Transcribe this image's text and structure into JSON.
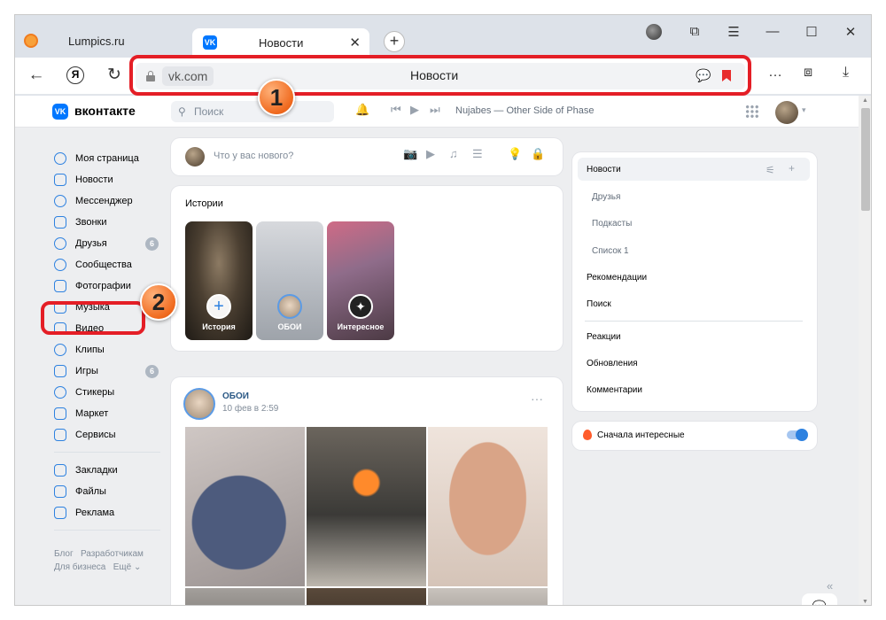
{
  "browser": {
    "inactive_tab": "Lumpics.ru",
    "active_tab": {
      "title": "Новости",
      "favicon": "VK",
      "close": "✕"
    },
    "new_tab": "+",
    "window_controls": {
      "extensions": "⧉",
      "menu": "☰",
      "minimize": "—",
      "maximize": "☐",
      "close": "✕"
    },
    "nav": {
      "back": "←",
      "yandex": "Я",
      "reload": "↻"
    },
    "address": {
      "domain": "vk.com",
      "title": "Новости"
    },
    "right_controls": {
      "more": "…",
      "downloads": "⤓",
      "bookmarks": "⧈"
    }
  },
  "annotations": {
    "badge_1": "1",
    "badge_2": "2",
    "color": "#e41e26"
  },
  "vk": {
    "logo_text": "вконтакте",
    "search_placeholder": "Поиск",
    "player": {
      "track": "Nujabes — Other Side of Phase"
    },
    "menu": [
      {
        "label": "Моя страница"
      },
      {
        "label": "Новости"
      },
      {
        "label": "Мессенджер"
      },
      {
        "label": "Звонки"
      },
      {
        "label": "Друзья",
        "count": "6"
      },
      {
        "label": "Сообщества"
      },
      {
        "label": "Фотографии"
      },
      {
        "label": "Музыка"
      },
      {
        "label": "Видео"
      },
      {
        "label": "Клипы"
      },
      {
        "label": "Игры",
        "count": "6"
      },
      {
        "label": "Стикеры"
      },
      {
        "label": "Маркет"
      },
      {
        "label": "Сервисы"
      },
      {
        "label": "Закладки"
      },
      {
        "label": "Файлы"
      },
      {
        "label": "Реклама"
      }
    ],
    "footer": {
      "blog": "Блог",
      "developers": "Разработчикам",
      "business": "Для бизнеса",
      "more": "Ещё"
    },
    "composer_placeholder": "Что у вас нового?",
    "stories": {
      "title": "Истории",
      "items": [
        {
          "label": "История",
          "icon": "+"
        },
        {
          "label": "ОБОИ"
        },
        {
          "label": "Интересное"
        }
      ]
    },
    "post": {
      "author": "ОБОИ",
      "date": "10 фев в 2:59",
      "menu": "···"
    },
    "right_nav": {
      "news": "Новости",
      "friends": "Друзья",
      "podcasts": "Подкасты",
      "list1": "Список 1",
      "recommendations": "Рекомендации",
      "search": "Поиск",
      "reactions": "Реакции",
      "updates": "Обновления",
      "comments": "Комментарии"
    },
    "sort": {
      "label": "Сначала интересные",
      "enabled": true
    },
    "accent_color": "#0077ff"
  }
}
